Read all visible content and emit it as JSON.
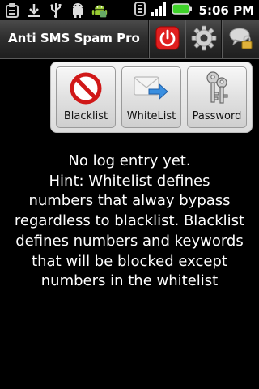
{
  "status_bar": {
    "time": "5:06",
    "ampm": "PM",
    "left_icons": [
      "sms-notification-icon",
      "download-icon",
      "usb-icon",
      "android-notification-icon",
      "android-bugdroid-icon"
    ],
    "right_icons": [
      "wifi-icon",
      "signal-icon",
      "battery-icon"
    ]
  },
  "title_bar": {
    "title": "Anti SMS Spam Pro",
    "actions": [
      "power-icon",
      "gear-icon",
      "lock-message-icon"
    ]
  },
  "panel": {
    "buttons": [
      {
        "label": "Blacklist",
        "icon": "no-entry-icon"
      },
      {
        "label": "WhiteList",
        "icon": "envelope-arrow-icon"
      },
      {
        "label": "Password",
        "icon": "keys-icon"
      }
    ]
  },
  "message": {
    "lines": [
      "No log entry yet.",
      "Hint: Whitelist defines",
      "numbers that alway bypass",
      "regardless to blacklist. Blacklist",
      "defines numbers and keywords",
      "that will be blocked except",
      "numbers in the whitelist"
    ]
  },
  "colors": {
    "background": "#000000",
    "accent_red": "#e01f1f",
    "battery_green": "#3fd22a"
  }
}
